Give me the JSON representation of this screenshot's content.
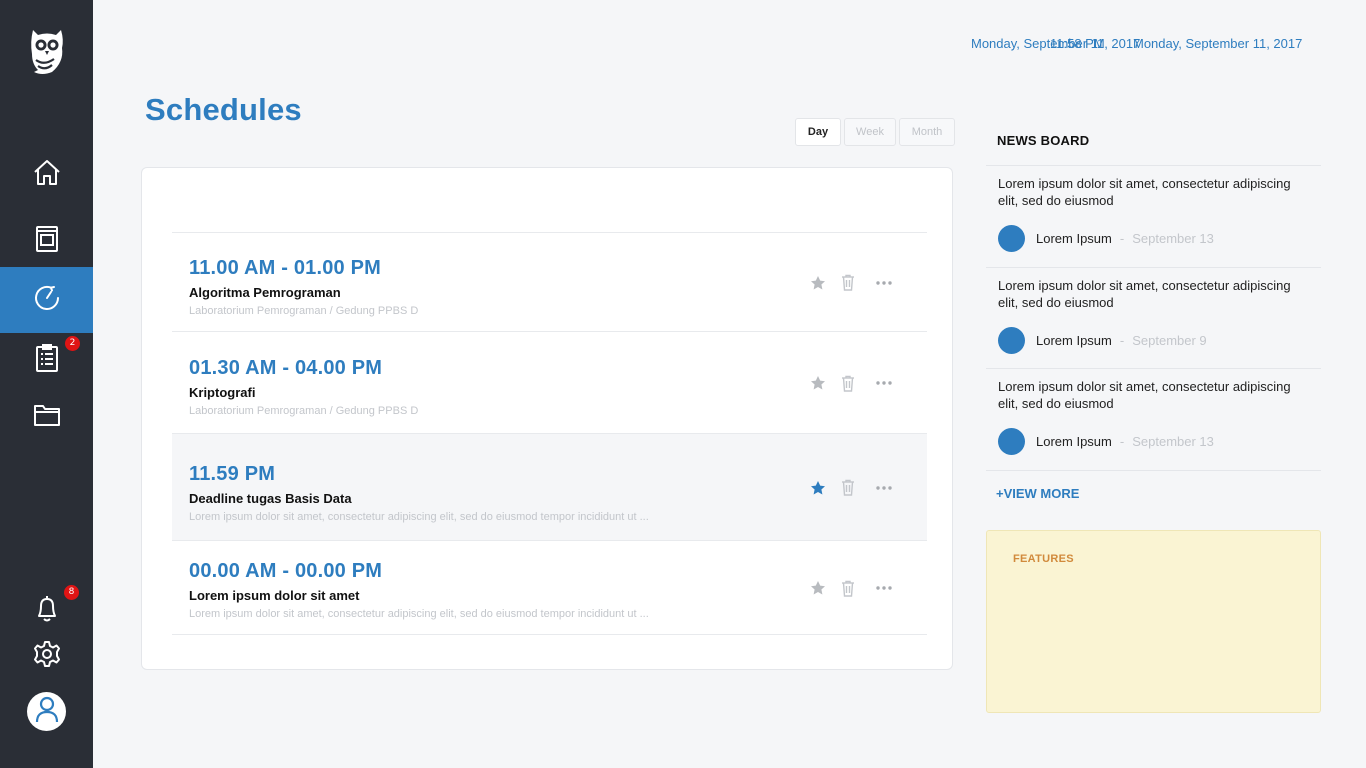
{
  "header": {
    "date_left": "Monday, September 11, 2017",
    "time": "11:58 PM",
    "date_right": "Monday, September 11, 2017"
  },
  "page": {
    "title": "Schedules"
  },
  "view_switch": {
    "options": [
      "Day",
      "Week",
      "Month"
    ],
    "selected": "Day"
  },
  "sidebar": {
    "items": [
      {
        "icon": "home-icon"
      },
      {
        "icon": "book-icon"
      },
      {
        "icon": "clock-icon",
        "active": true
      },
      {
        "icon": "clipboard-icon",
        "badge": "2"
      },
      {
        "icon": "folder-icon"
      }
    ],
    "bottom": [
      {
        "icon": "bell-icon",
        "badge": "8"
      },
      {
        "icon": "gear-icon"
      },
      {
        "icon": "user-icon"
      }
    ]
  },
  "schedules": [
    {
      "time": "11.00 AM - 01.00 PM",
      "title": "Algoritma Pemrograman",
      "subtitle": "Laboratorium Pemrograman / Gedung PPBS D",
      "starred": false
    },
    {
      "time": "01.30 AM - 04.00 PM",
      "title": "Kriptografi",
      "subtitle": "Laboratorium Pemrograman / Gedung PPBS D",
      "starred": false
    },
    {
      "time": "11.59 PM",
      "title": "Deadline tugas Basis Data",
      "subtitle": "Lorem ipsum dolor sit amet, consectetur adipiscing elit, sed do eiusmod tempor incididunt ut ...",
      "starred": true
    },
    {
      "time": "00.00 AM - 00.00 PM",
      "title": "Lorem ipsum dolor sit amet",
      "subtitle": "Lorem ipsum dolor sit amet, consectetur adipiscing elit, sed do eiusmod tempor incididunt ut ...",
      "starred": false
    }
  ],
  "news": {
    "title": "NEWS BOARD",
    "items": [
      {
        "text": "Lorem ipsum dolor sit amet, consectetur adipiscing elit, sed do eiusmod",
        "author": "Lorem Ipsum",
        "sep": "-",
        "date": "September 13"
      },
      {
        "text": "Lorem ipsum dolor sit amet, consectetur adipiscing elit, sed do eiusmod",
        "author": "Lorem Ipsum",
        "sep": "-",
        "date": "September 9"
      },
      {
        "text": "Lorem ipsum dolor sit amet, consectetur adipiscing elit, sed do eiusmod",
        "author": "Lorem Ipsum",
        "sep": "-",
        "date": "September 13"
      }
    ],
    "view_more": "+VIEW MORE"
  },
  "features": {
    "title": "FEATURES"
  },
  "colors": {
    "accent": "#2e7dbf",
    "sidebar": "#2a2e36",
    "badge": "#e01414",
    "star_active": "#2e7dbf",
    "star_inactive": "#b8bbbf",
    "features_bg": "#faf4d3",
    "features_title": "#d18a3c"
  }
}
